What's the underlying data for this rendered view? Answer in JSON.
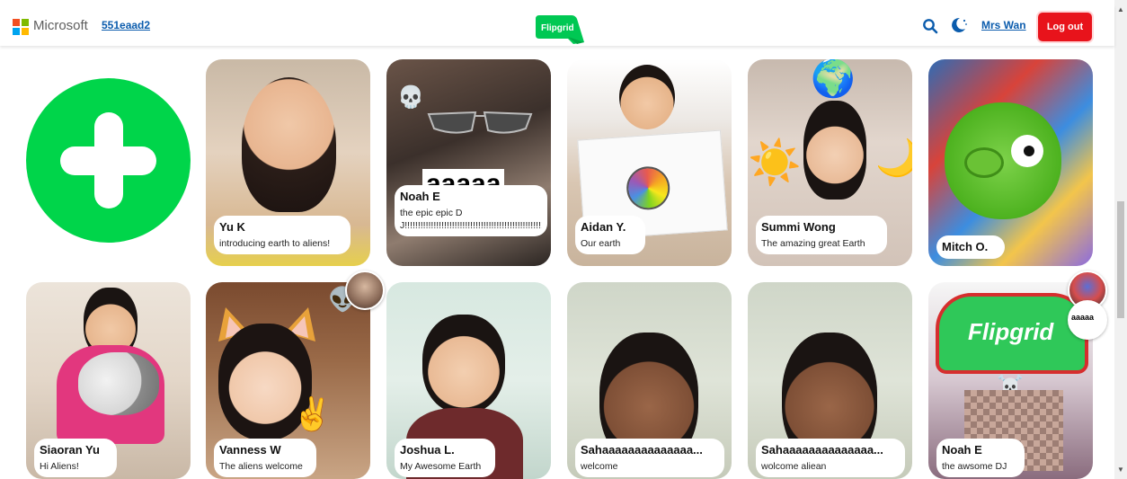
{
  "header": {
    "brand": "Microsoft",
    "group_code": "551eaad2",
    "logo_text": "Flipgrid",
    "user_name": "Mrs Wan",
    "logout_label": "Log out"
  },
  "colors": {
    "accent_green": "#00d54a",
    "logout_red": "#e8131b",
    "link_blue": "#0b5cad"
  },
  "icons": [
    "search-icon",
    "moon-icon",
    "plus-icon",
    "skull-emoji",
    "globe-emoji",
    "sun-emoji",
    "moon-emoji",
    "alien-emoji",
    "skull-crossbones-emoji"
  ],
  "row1": [
    {
      "name": "Yu K",
      "caption": "introducing earth to aliens!"
    },
    {
      "name": "Noah E",
      "caption": "the epic epic DJ!!!!!!!!!!!!!!!!!!!!!!!!!!!!!!!!!!!!!!!!!!!!!!!!!!!!!!!!!!",
      "overlay_text": "aaaaa"
    },
    {
      "name": "Aidan Y.",
      "caption": "Our earth"
    },
    {
      "name": "Summi Wong",
      "caption": "The amazing great Earth"
    },
    {
      "name": "Mitch O.",
      "caption": ""
    }
  ],
  "row2": [
    {
      "name": "Siaoran Yu",
      "caption": "Hi Aliens!"
    },
    {
      "name": "Vanness W",
      "caption": "The aliens welcome"
    },
    {
      "name": "Joshua L.",
      "caption": "My Awesome Earth"
    },
    {
      "name": "Sahaaaaaaaaaaaaaa...",
      "caption": "welcome"
    },
    {
      "name": "Sahaaaaaaaaaaaaaa...",
      "caption": "wolcome aliean"
    },
    {
      "name": "Noah E",
      "caption": "the awsome DJ",
      "hat_text": "Flipgrid",
      "bubble_text": "aaaaa"
    }
  ]
}
